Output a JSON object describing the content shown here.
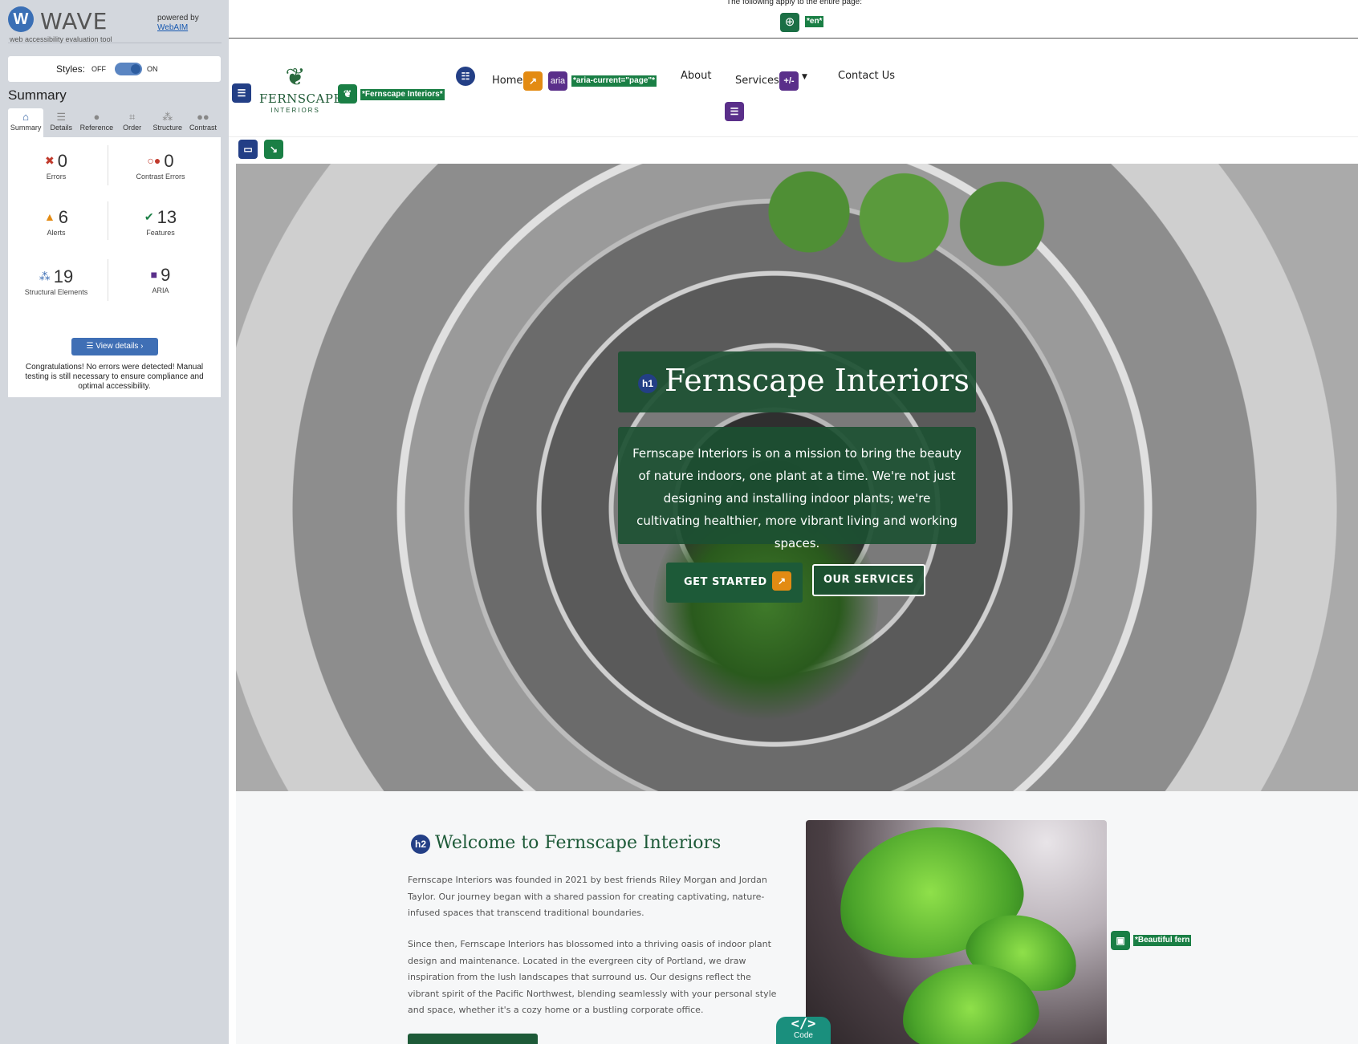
{
  "wave": {
    "logo_letter": "W",
    "name": "WAVE",
    "tagline": "web accessibility evaluation tool",
    "powered_by": "powered by",
    "webaim_link": "WebAIM",
    "styles_label": "Styles:",
    "styles_off": "OFF",
    "styles_on": "ON",
    "summary_heading": "Summary",
    "tabs": [
      {
        "label": "Summary",
        "icon": "home-icon"
      },
      {
        "label": "Details",
        "icon": "list-icon"
      },
      {
        "label": "Reference",
        "icon": "info-icon"
      },
      {
        "label": "Order",
        "icon": "order-icon"
      },
      {
        "label": "Structure",
        "icon": "structure-icon"
      },
      {
        "label": "Contrast",
        "icon": "contrast-icon"
      }
    ],
    "stats": {
      "errors": {
        "value": "0",
        "label": "Errors"
      },
      "contrast_errors": {
        "value": "0",
        "label": "Contrast Errors"
      },
      "alerts": {
        "value": "6",
        "label": "Alerts"
      },
      "features": {
        "value": "13",
        "label": "Features"
      },
      "structural": {
        "value": "19",
        "label": "Structural Elements"
      },
      "aria": {
        "value": "9",
        "label": "ARIA"
      }
    },
    "view_details": "View details ›",
    "congrats": "Congratulations! No errors were detected! Manual testing is still necessary to ensure compliance and optimal accessibility."
  },
  "page": {
    "top_note": "The following apply to the entire page:",
    "lang_tag": "*en*",
    "logo_alt_tag": "*Fernscape Interiors*",
    "logo_line1": "FERNSCAPE",
    "logo_line2": "INTERIORS",
    "nav": {
      "home": "Home",
      "aria_badge": "aria",
      "aria_current_tag": "*aria-current=\"page\"*",
      "about": "About",
      "services": "Services",
      "expand_badge": "+/-",
      "contact": "Contact Us"
    },
    "hero": {
      "h1_badge": "h1",
      "title": "Fernscape Interiors",
      "text": "Fernscape Interiors is on a mission to bring the beauty of nature indoors, one plant at a time. We're not just designing and installing indoor plants; we're cultivating healthier, more vibrant living and working spaces.",
      "btn_get_started": "GET STARTED",
      "btn_services": "OUR SERVICES"
    },
    "welcome": {
      "h2_badge": "h2",
      "title": "Welcome to Fernscape Interiors",
      "para1": "Fernscape Interiors was founded in 2021 by best friends Riley Morgan and Jordan Taylor. Our journey began with a shared passion for creating captivating, nature-infused spaces that transcend traditional boundaries.",
      "para2": "Since then, Fernscape Interiors has blossomed into a thriving oasis of indoor plant design and maintenance. Located in the evergreen city of Portland, we draw inspiration from the lush landscapes that surround us. Our designs reflect the vibrant spirit of the Pacific Northwest, blending seamlessly with your personal style and space, whether it's a cozy home or a bustling corporate office.",
      "image_alt_tag": "*Beautiful fern"
    },
    "code_tab": "</>",
    "code_label": "Code"
  },
  "colors": {
    "brand_green": "#1d5a38",
    "wave_blue": "#3f6fb5",
    "error_red": "#c0392b",
    "alert_orange": "#e38b13",
    "feature_green": "#1a7f45",
    "aria_purple": "#5a2f8a"
  }
}
